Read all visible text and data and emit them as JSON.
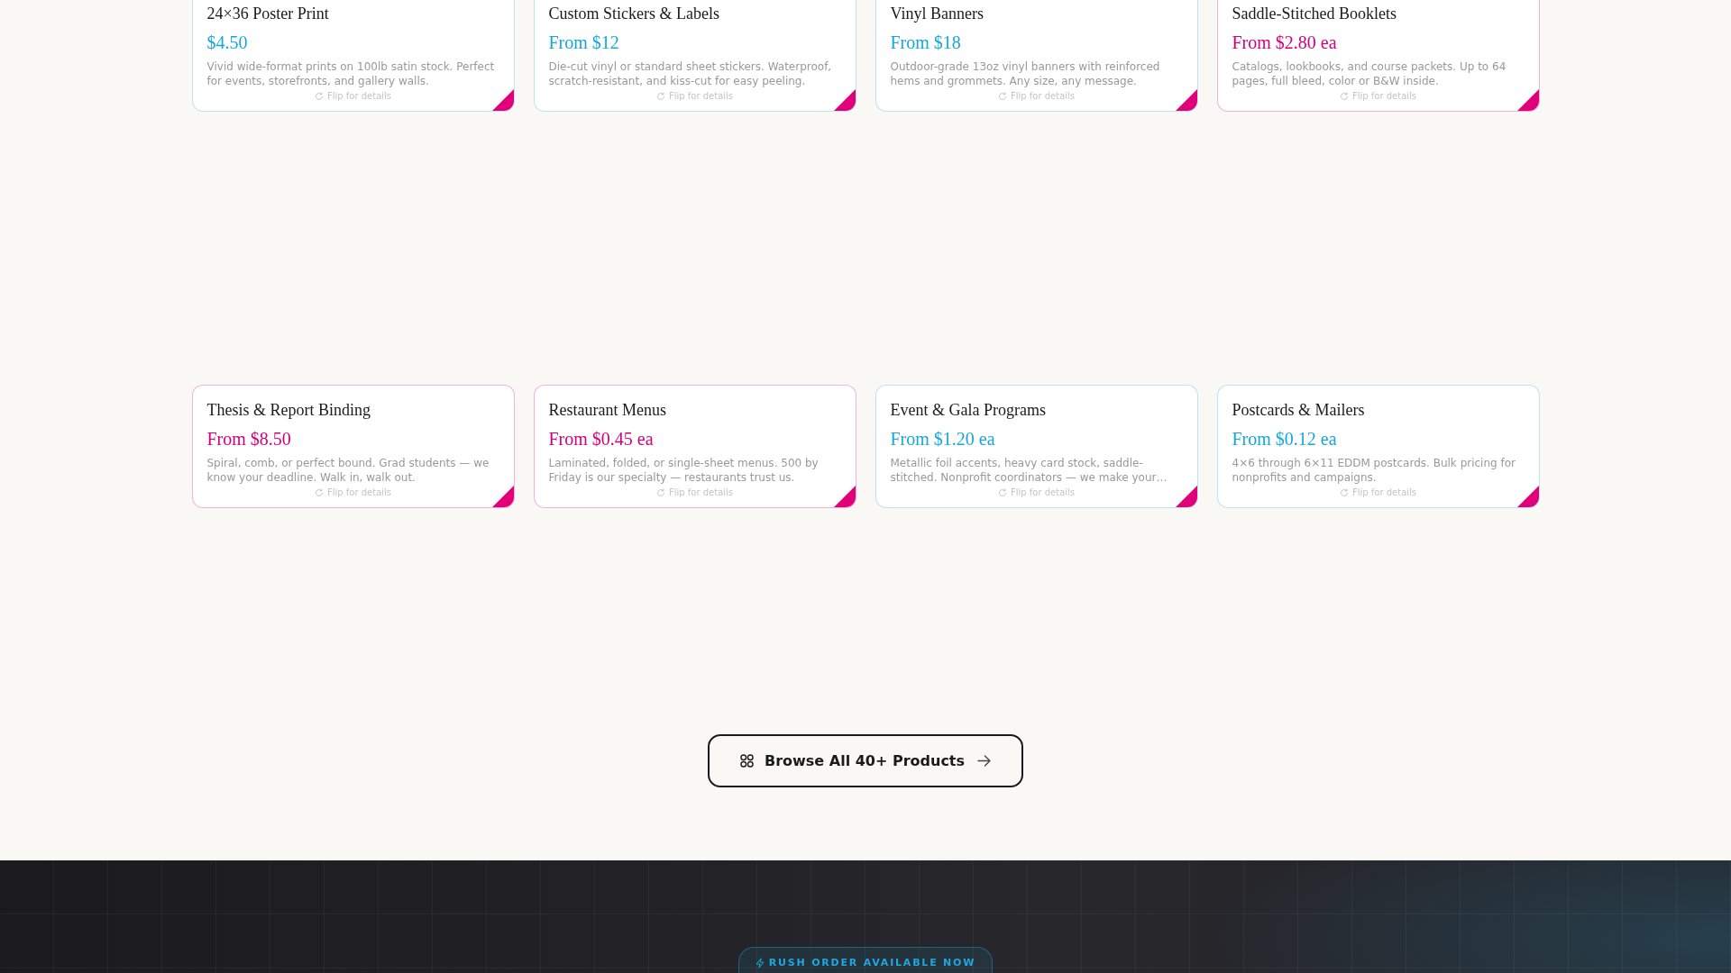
{
  "product_grid": {
    "cards": [
      {
        "title": "24×36 Poster Print",
        "price": "$4.50",
        "description": "Vivid wide-format prints on 100lb satin stock. Perfect for events, storefronts, and gallery walls.",
        "hint": "Flip for details",
        "color": "#16a6d9"
      },
      {
        "title": "Custom Stickers & Labels",
        "price": "From $12",
        "description": "Die-cut vinyl or standard sheet stickers. Waterproof, scratch-resistant, and kiss-cut for easy peeling.",
        "hint": "Flip for details",
        "color": "#16a6d9"
      },
      {
        "title": "Vinyl Banners",
        "price": "From $18",
        "description": "Outdoor-grade 13oz vinyl banners with reinforced hems and grommets. Any size, any message.",
        "hint": "Flip for details",
        "color": "#16a6d9"
      },
      {
        "title": "Saddle-Stitched Booklets",
        "price": "From $2.80 ea",
        "description": "Catalogs, lookbooks, and course packets. Up to 64 pages, full bleed, color or B&W inside.",
        "hint": "Flip for details",
        "color": "#d1007e"
      },
      {
        "title": "Thesis & Report Binding",
        "price": "From $8.50",
        "description": "Spiral, comb, or perfect bound. Grad students — we know your deadline. Walk in, walk out.",
        "hint": "Flip for details",
        "color": "#d1007e"
      },
      {
        "title": "Restaurant Menus",
        "price": "From $0.45 ea",
        "description": "Laminated, folded, or single-sheet menus. 500 by Friday is our specialty — restaurants trust us.",
        "hint": "Flip for details",
        "color": "#d1007e"
      },
      {
        "title": "Event & Gala Programs",
        "price": "From $1.20 ea",
        "description": "Metallic foil accents, heavy card stock, saddle-stitched. Nonprofit coordinators — we make your…",
        "hint": "Flip for details",
        "color": "#16a6d9"
      },
      {
        "title": "Postcards & Mailers",
        "price": "From $0.12 ea",
        "description": "4×6 through 6×11 EDDM postcards. Bulk pricing for nonprofits and campaigns.",
        "hint": "Flip for details",
        "color": "#16a6d9"
      }
    ]
  },
  "browse_button": {
    "label": "Browse All 40+ Products"
  },
  "rush_section": {
    "tag": "RUSH ORDER AVAILABLE NOW"
  }
}
